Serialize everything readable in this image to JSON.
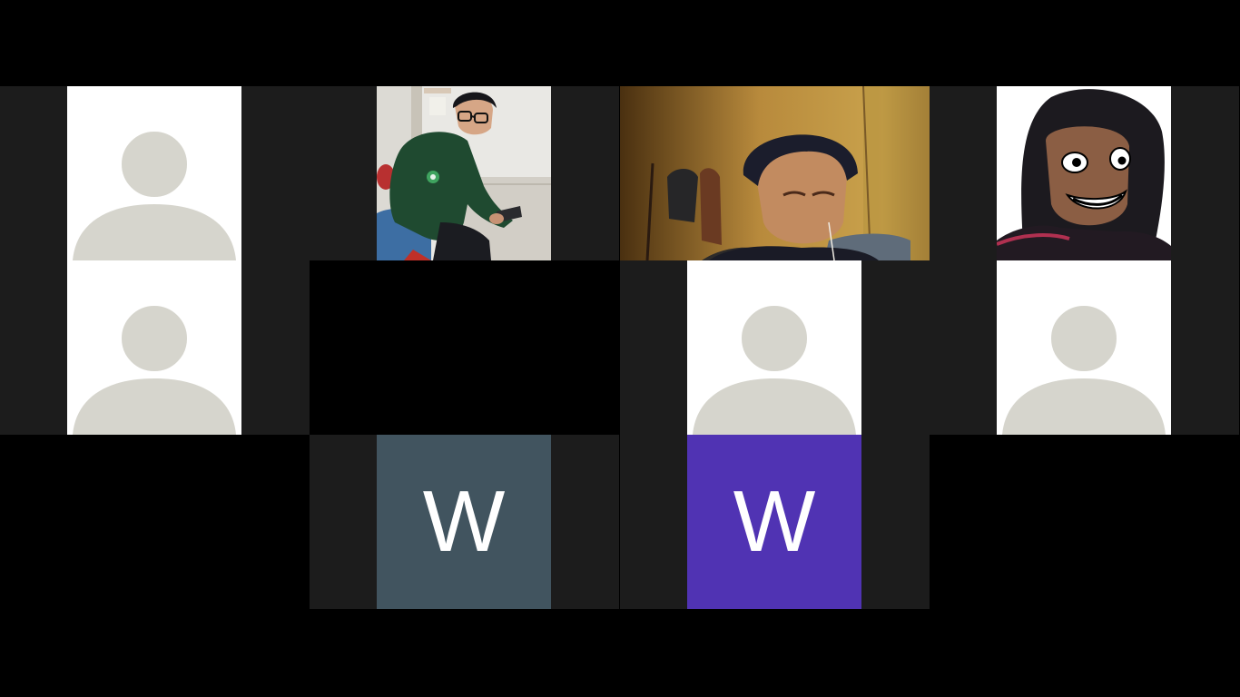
{
  "app": {
    "view": "gallery"
  },
  "colors": {
    "page_background": "#000000",
    "tile_background": "#1c1c1c",
    "avatar_background": "#ffffff",
    "avatar_silhouette": "#d6d5cd",
    "initial_text": "#ffffff"
  },
  "participants": [
    {
      "id": "p1",
      "kind": "avatar",
      "icon": "default-avatar-icon"
    },
    {
      "id": "p2",
      "kind": "video",
      "scene": "person-green-jacket-holding-phone"
    },
    {
      "id": "p3",
      "kind": "video",
      "scene": "person-warm-lit-room"
    },
    {
      "id": "p4",
      "kind": "video",
      "scene": "person-with-drawn-face-overlay"
    },
    {
      "id": "p5",
      "kind": "avatar",
      "icon": "default-avatar-icon"
    },
    {
      "id": "p6",
      "kind": "video-off"
    },
    {
      "id": "p7",
      "kind": "avatar",
      "icon": "default-avatar-icon"
    },
    {
      "id": "p8",
      "kind": "avatar",
      "icon": "default-avatar-icon"
    },
    {
      "id": "p9",
      "kind": "initial",
      "initial": "W",
      "color": "#41545f"
    },
    {
      "id": "p10",
      "kind": "initial",
      "initial": "W",
      "color": "#5033b3"
    }
  ]
}
